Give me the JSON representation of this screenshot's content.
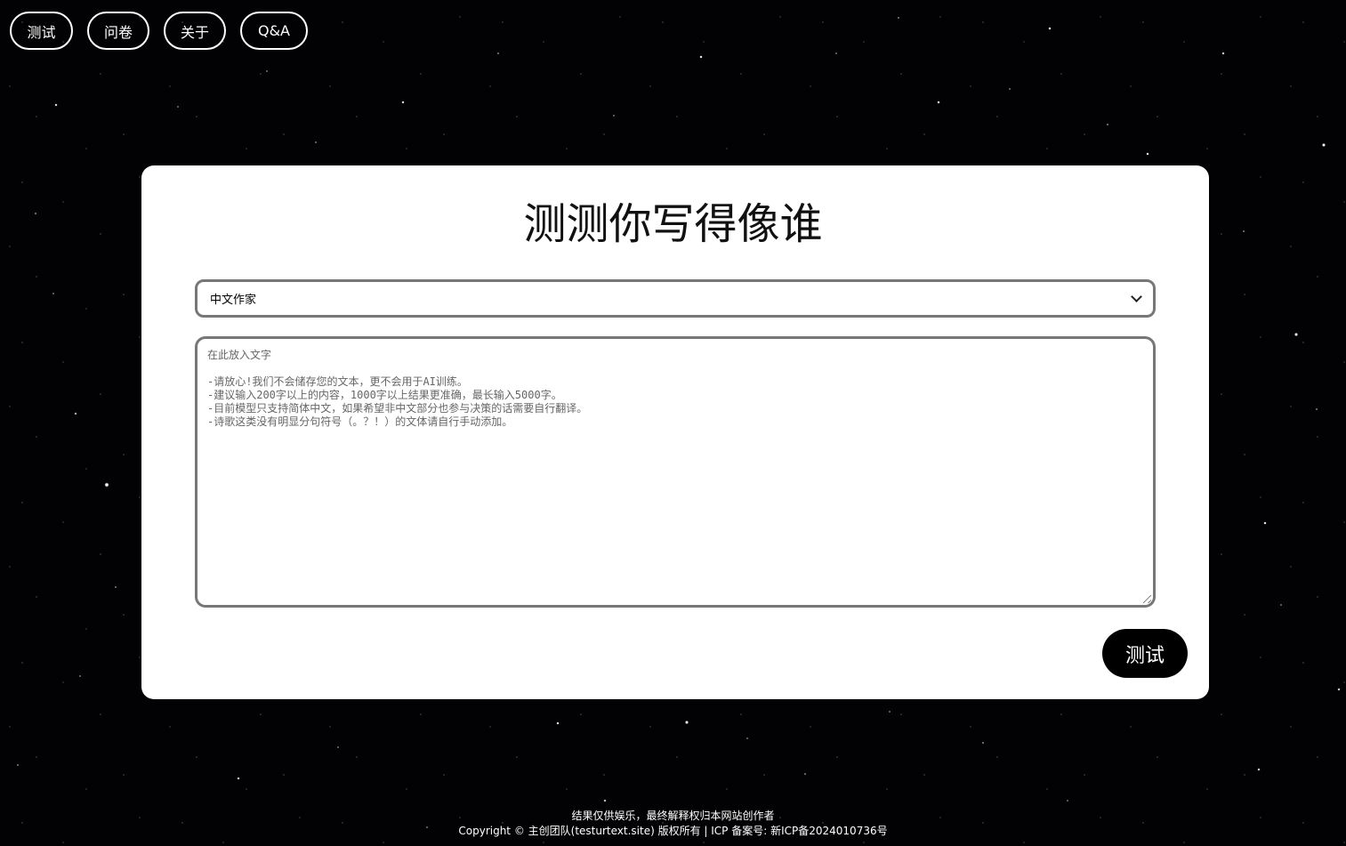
{
  "nav": {
    "items": [
      {
        "label": "测试"
      },
      {
        "label": "问卷"
      },
      {
        "label": "关于"
      },
      {
        "label": "Q&A"
      }
    ]
  },
  "main": {
    "title": "测测你写得像谁",
    "select": {
      "value": "中文作家"
    },
    "textarea": {
      "placeholder_lines": [
        "在此放入文字",
        "",
        "-请放心!我们不会储存您的文本，更不会用于AI训练。",
        "-建议输入200字以上的内容，1000字以上结果更准确，最长输入5000字。",
        "-目前模型只支持简体中文，如果希望非中文部分也参与决策的话需要自行翻译。",
        "-诗歌这类没有明显分句符号（。？！）的文体请自行手动添加。"
      ]
    },
    "submit_label": "测试"
  },
  "footer": {
    "disclaimer": "结果仅供娱乐，最终解释权归本网站创作者",
    "copyright_prefix": "Copyright © 主创团队(",
    "site_link": "testurtext.site",
    "copyright_suffix": ") 版权所有 | ICP 备案号: ",
    "icp_number": "新ICP备2024010736号"
  },
  "colors": {
    "background": "#020204",
    "card": "#ffffff",
    "border": "#777777",
    "button_bg": "#000000",
    "text_light": "#ffffff"
  }
}
